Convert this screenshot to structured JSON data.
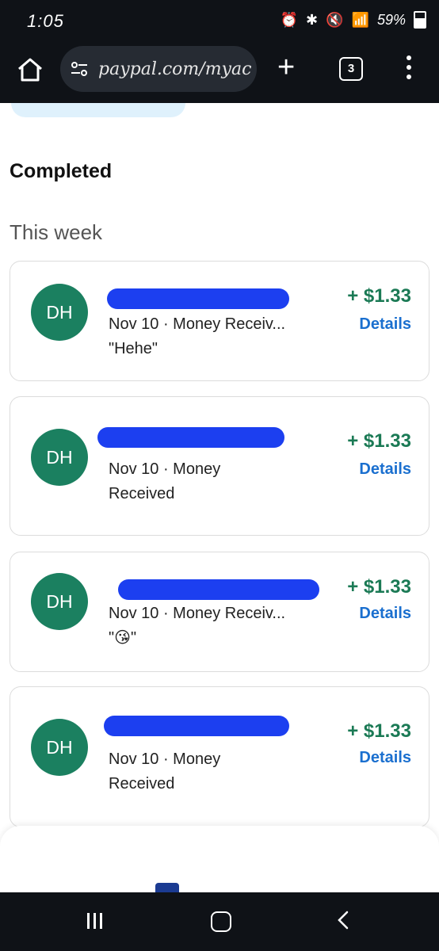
{
  "status": {
    "time": "1:05",
    "battery": "59%"
  },
  "browser": {
    "url": "paypal.com/myac",
    "tab_count": "3",
    "plus": "+"
  },
  "sections": {
    "completed": "Completed",
    "this_week": "This week"
  },
  "transactions": [
    {
      "initials": "DH",
      "date": "Nov 10",
      "separator": "·",
      "type": "Money Receiv...",
      "note": "\"Hehe\"",
      "amount": "+ $1.33",
      "details": "Details"
    },
    {
      "initials": "DH",
      "date": "Nov 10",
      "separator": "·",
      "type": "Money",
      "note": "Received",
      "amount": "+ $1.33",
      "details": "Details"
    },
    {
      "initials": "DH",
      "date": "Nov 10",
      "separator": "·",
      "type": "Money Receiv...",
      "note": "\"😘\"",
      "amount": "+ $1.33",
      "details": "Details"
    },
    {
      "initials": "DH",
      "date": "Nov 10",
      "separator": "·",
      "type": "Money",
      "note": "Received",
      "amount": "+ $1.33",
      "details": "Details"
    }
  ],
  "colors": {
    "avatar": "#1b8060",
    "amount": "#1b7a55",
    "details": "#1a6fcf",
    "redaction": "#1c3ff0",
    "bar": "#0f1217"
  }
}
